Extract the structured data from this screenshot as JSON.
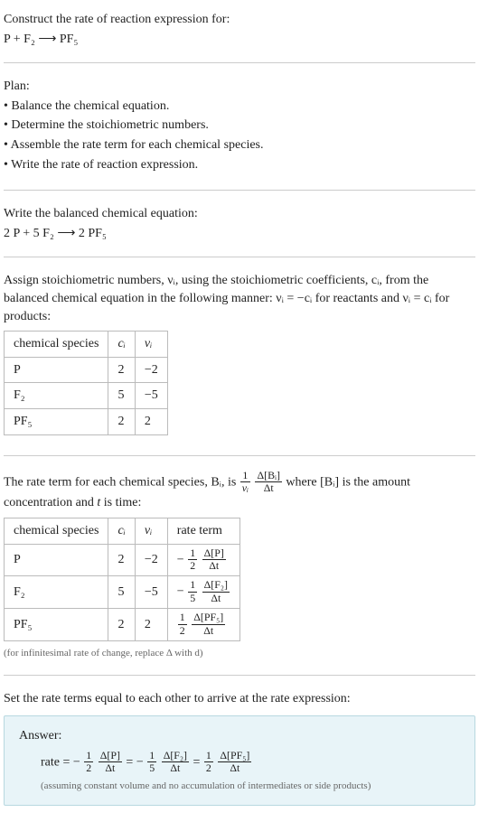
{
  "header": {
    "prompt": "Construct the rate of reaction expression for:",
    "equation": "P + F₂ ⟶ PF₅"
  },
  "plan": {
    "label": "Plan:",
    "items": [
      "• Balance the chemical equation.",
      "• Determine the stoichiometric numbers.",
      "• Assemble the rate term for each chemical species.",
      "• Write the rate of reaction expression."
    ]
  },
  "balanced": {
    "label": "Write the balanced chemical equation:",
    "equation": "2 P + 5 F₂ ⟶ 2 PF₅"
  },
  "stoich": {
    "intro": "Assign stoichiometric numbers, νᵢ, using the stoichiometric coefficients, cᵢ, from the balanced chemical equation in the following manner: νᵢ = −cᵢ for reactants and νᵢ = cᵢ for products:",
    "table": {
      "headers": [
        "chemical species",
        "cᵢ",
        "νᵢ"
      ],
      "rows": [
        [
          "P",
          "2",
          "−2"
        ],
        [
          "F₂",
          "5",
          "−5"
        ],
        [
          "PF₅",
          "2",
          "2"
        ]
      ]
    }
  },
  "rateterm": {
    "intro_part1": "The rate term for each chemical species, Bᵢ, is ",
    "intro_part2": " where [Bᵢ] is the amount concentration and ",
    "intro_part3": "t",
    "intro_part4": " is time:",
    "frac1": {
      "num": "1",
      "den": "νᵢ"
    },
    "frac2": {
      "num": "Δ[Bᵢ]",
      "den": "Δt"
    },
    "table": {
      "headers": [
        "chemical species",
        "cᵢ",
        "νᵢ",
        "rate term"
      ],
      "rows": [
        {
          "species": "P",
          "ci": "2",
          "vi": "−2",
          "sign": "−",
          "coef_num": "1",
          "coef_den": "2",
          "conc_num": "Δ[P]",
          "conc_den": "Δt"
        },
        {
          "species": "F₂",
          "ci": "5",
          "vi": "−5",
          "sign": "−",
          "coef_num": "1",
          "coef_den": "5",
          "conc_num": "Δ[F₂]",
          "conc_den": "Δt"
        },
        {
          "species": "PF₅",
          "ci": "2",
          "vi": "2",
          "sign": "",
          "coef_num": "1",
          "coef_den": "2",
          "conc_num": "Δ[PF₅]",
          "conc_den": "Δt"
        }
      ]
    },
    "note": "(for infinitesimal rate of change, replace Δ with d)"
  },
  "setequal": {
    "text": "Set the rate terms equal to each other to arrive at the rate expression:"
  },
  "answer": {
    "label": "Answer:",
    "prefix": "rate = ",
    "terms": [
      {
        "sign": "−",
        "coef_num": "1",
        "coef_den": "2",
        "conc_num": "Δ[P]",
        "conc_den": "Δt"
      },
      {
        "sign": "−",
        "coef_num": "1",
        "coef_den": "5",
        "conc_num": "Δ[F₂]",
        "conc_den": "Δt"
      },
      {
        "sign": "",
        "coef_num": "1",
        "coef_den": "2",
        "conc_num": "Δ[PF₅]",
        "conc_den": "Δt"
      }
    ],
    "eq": " = ",
    "note": "(assuming constant volume and no accumulation of intermediates or side products)"
  }
}
